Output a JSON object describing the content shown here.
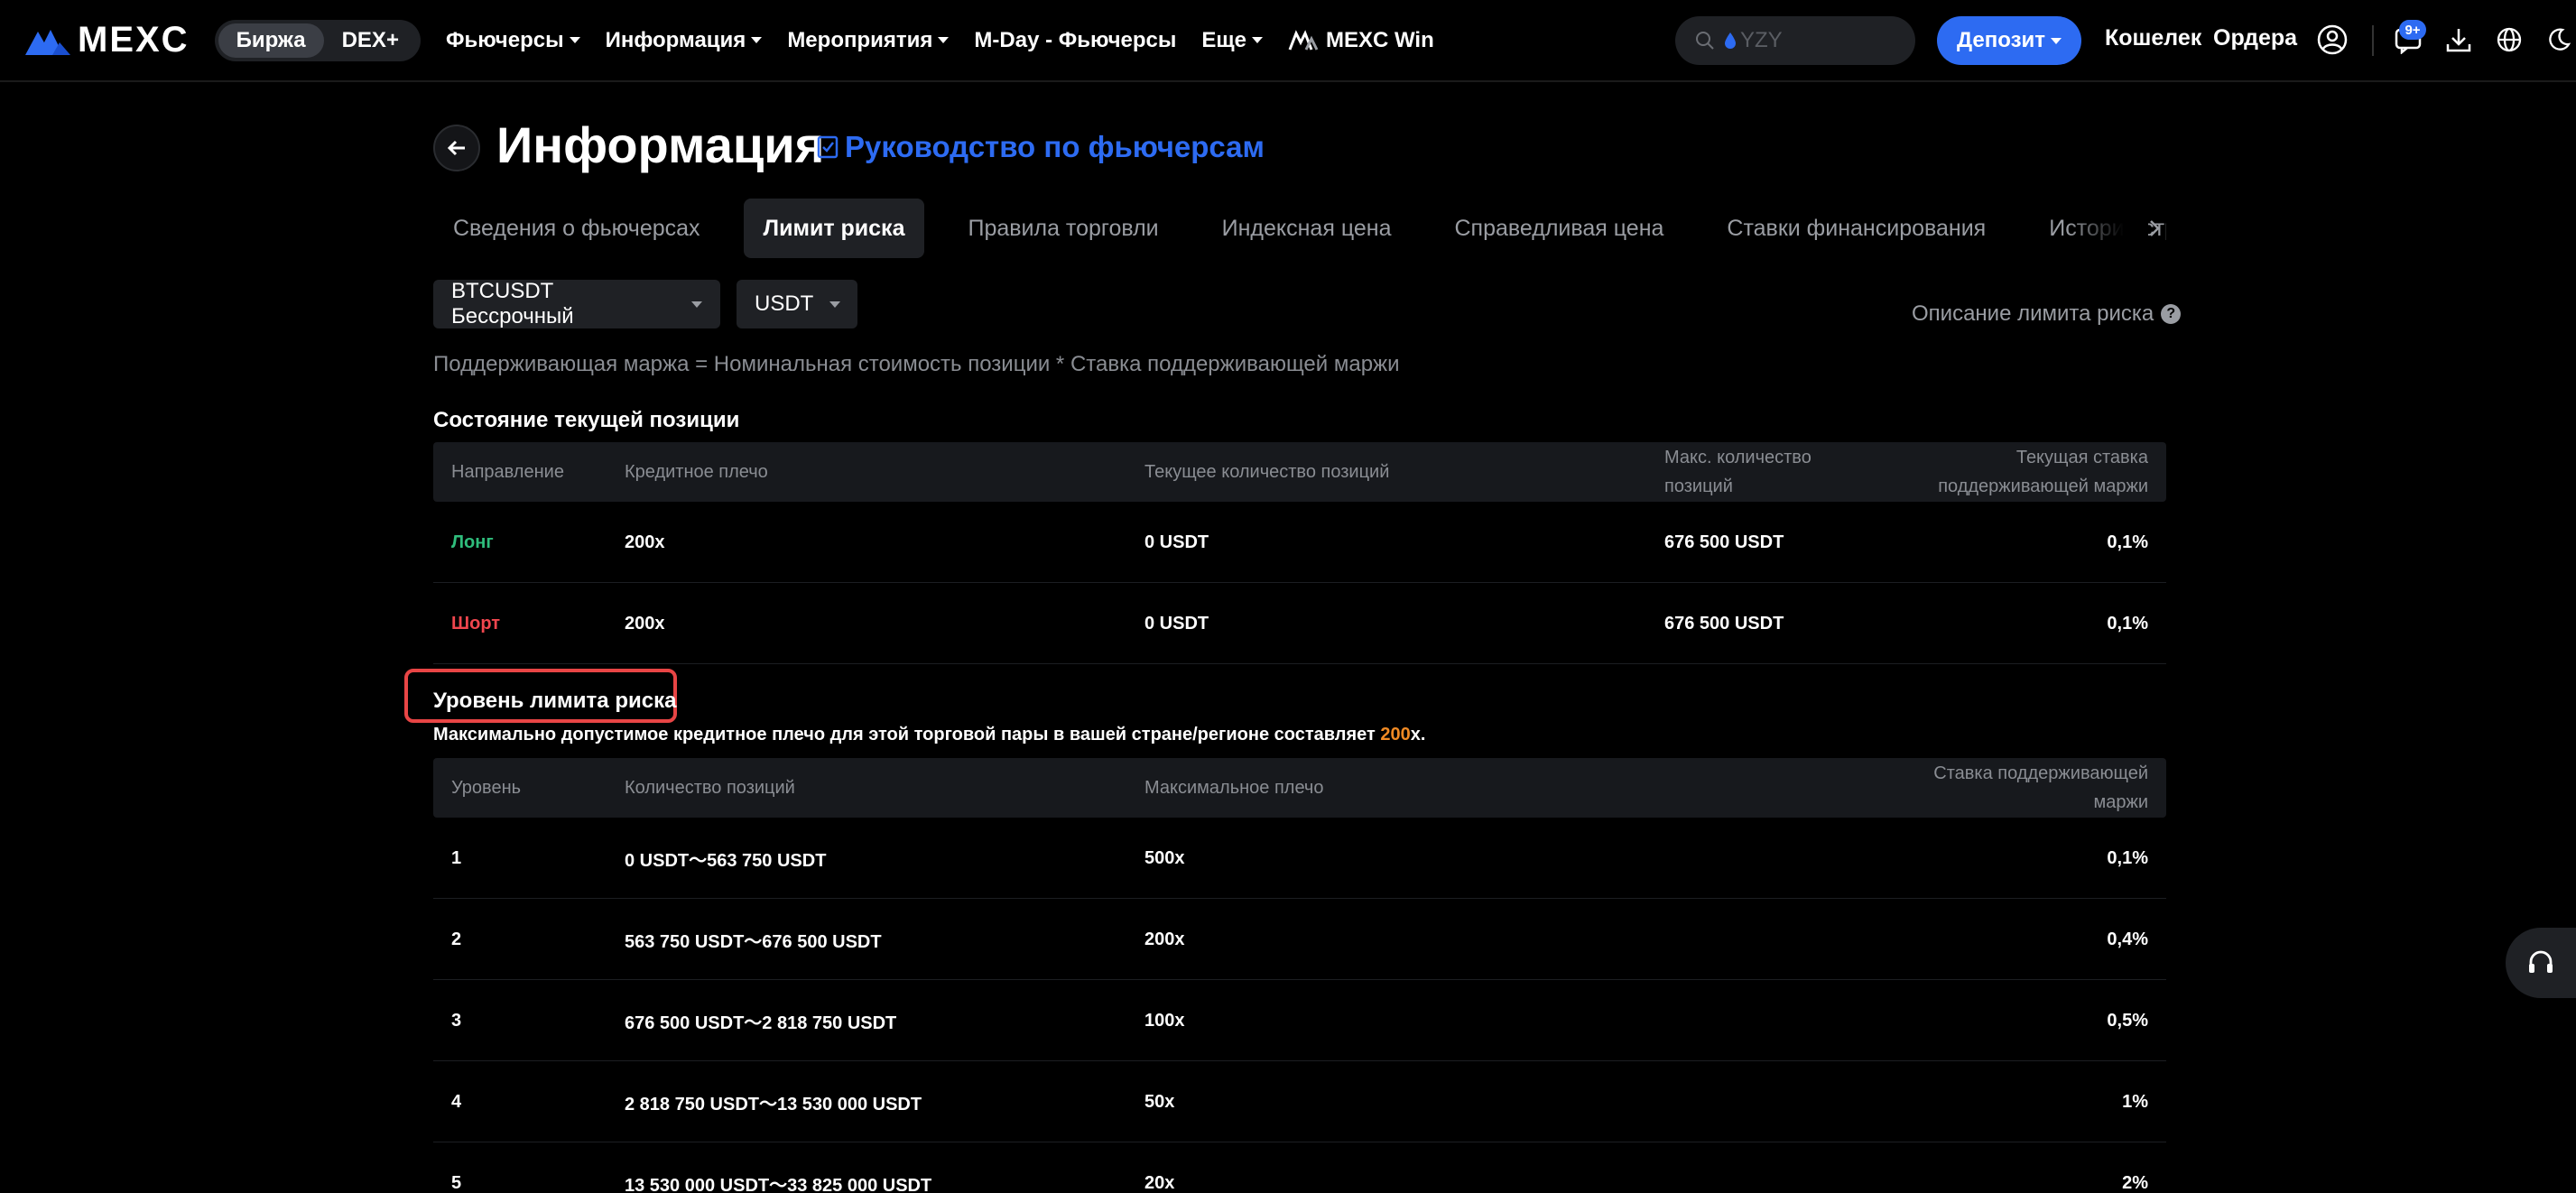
{
  "brand": {
    "name": "MEXC",
    "accent": "#2d6bf2"
  },
  "header": {
    "segments": [
      {
        "label": "Биржа",
        "active": true
      },
      {
        "label": "DEX+",
        "active": false
      }
    ],
    "nav": [
      {
        "label": "Фьючерсы",
        "dropdown": true
      },
      {
        "label": "Информация",
        "dropdown": true
      },
      {
        "label": "Мероприятия",
        "dropdown": true
      },
      {
        "label": "M-Day - Фьючерсы",
        "dropdown": false
      },
      {
        "label": "Еще",
        "dropdown": true
      },
      {
        "label": "MEXC Win",
        "dropdown": false
      }
    ],
    "search": {
      "placeholder": "YZY"
    },
    "deposit_label": "Депозит",
    "wallet_label": "Кошелек",
    "orders_label": "Ордера",
    "notifications_badge": "9+"
  },
  "page": {
    "title": "Информация",
    "guide_link": "Руководство по фьючерсам",
    "tabs": [
      "Сведения о фьючерсах",
      "Лимит риска",
      "Правила торговли",
      "Индексная цена",
      "Справедливая цена",
      "Ставки финансирования",
      "История стр"
    ],
    "active_tab": 1,
    "symbol_select": "BTCUSDT Бессрочный",
    "currency_select": "USDT",
    "risk_limit_desc": "Описание лимита риска",
    "help_glyph": "?",
    "formula": "Поддерживающая маржа = Номинальная стоимость позиции * Ставка поддерживающей маржи"
  },
  "current_position": {
    "title": "Состояние текущей позиции",
    "headers": {
      "direction": "Направление",
      "leverage": "Кредитное плечо",
      "current_qty": "Текущее количество позиций",
      "max_qty_1": "Макс. количество",
      "max_qty_2": "позиций",
      "mm_rate_1": "Текущая ставка",
      "mm_rate_2": "поддерживающей маржи"
    },
    "rows": [
      {
        "direction": "Лонг",
        "side": "long",
        "leverage": "200x",
        "current_qty": "0 USDT",
        "max_qty": "676 500 USDT",
        "mm_rate": "0,1%"
      },
      {
        "direction": "Шорт",
        "side": "short",
        "leverage": "200x",
        "current_qty": "0 USDT",
        "max_qty": "676 500 USDT",
        "mm_rate": "0,1%"
      }
    ]
  },
  "risk_levels": {
    "title": "Уровень лимита риска",
    "note_prefix": "Максимально допустимое кредитное плечо для этой торговой пары в вашей стране/регионе составляет ",
    "note_value": "200",
    "note_suffix": "x.",
    "headers": {
      "level": "Уровень",
      "position_qty": "Количество позиций",
      "max_leverage": "Максимальное плечо",
      "mm_rate_1": "Ставка поддерживающей",
      "mm_rate_2": "маржи"
    },
    "rows": [
      {
        "level": "1",
        "range": "0 USDT～563 750 USDT",
        "max_leverage": "500x",
        "mm_rate": "0,1%"
      },
      {
        "level": "2",
        "range": "563 750 USDT～676 500 USDT",
        "max_leverage": "200x",
        "mm_rate": "0,4%"
      },
      {
        "level": "3",
        "range": "676 500 USDT～2 818 750 USDT",
        "max_leverage": "100x",
        "mm_rate": "0,5%"
      },
      {
        "level": "4",
        "range": "2 818 750 USDT～13 530 000 USDT",
        "max_leverage": "50x",
        "mm_rate": "1%"
      },
      {
        "level": "5",
        "range": "13 530 000 USDT～33 825 000 USDT",
        "max_leverage": "20x",
        "mm_rate": "2%"
      }
    ]
  },
  "colors": {
    "long": "#2fbd7c",
    "short": "#f0464e",
    "highlight": "#f08a24",
    "annotation": "#e84545"
  }
}
